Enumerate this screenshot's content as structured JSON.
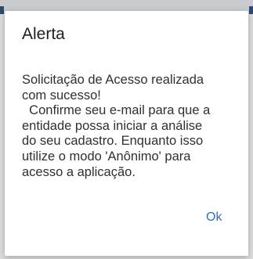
{
  "dialog": {
    "title": "Alerta",
    "message": "Solicitação de Acesso realizada\ncom sucesso!\n  Confirme seu e-mail para que a\nentidade possa iniciar a análise\ndo seu cadastro. Enquanto isso\nutilize o modo 'Anônimo' para\nacesso a aplicação.",
    "ok_label": "Ok"
  },
  "colors": {
    "accent": "#2f6fbe",
    "dialog_background": "#ffffff",
    "scrim": "#dcdcdc"
  }
}
